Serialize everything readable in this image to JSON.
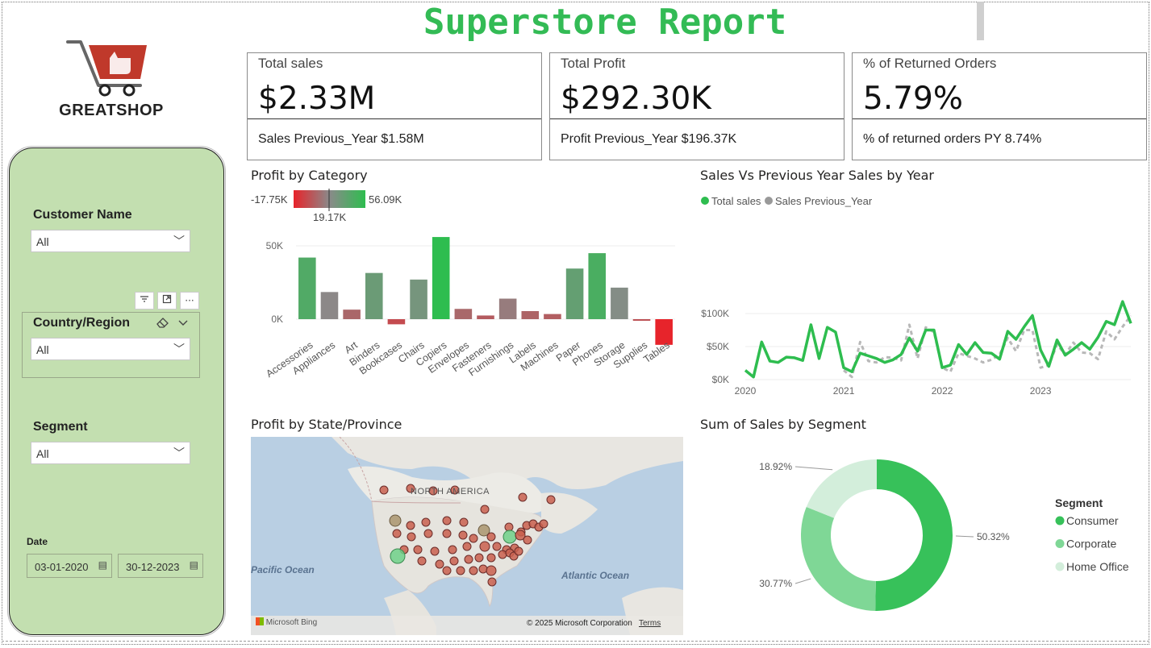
{
  "report": {
    "title": "Superstore Report",
    "logo_text": "GREATSHOP"
  },
  "colors": {
    "title": "#33bb55",
    "sidebar_bg": "#c3dfb0",
    "positive": "#2ebd4f",
    "negative": "#e8232a",
    "neutral": "#8a8a8a"
  },
  "filters": {
    "customer_name": {
      "label": "Customer Name",
      "value": "All"
    },
    "country_region": {
      "label": "Country/Region",
      "value": "All"
    },
    "segment": {
      "label": "Segment",
      "value": "All"
    },
    "date": {
      "label": "Date",
      "start": "03-01-2020",
      "end": "30-12-2023"
    },
    "toolbar_icons": [
      "filter-icon",
      "focus-mode-icon",
      "more-options-icon"
    ],
    "slicer_icons": [
      "eraser-icon",
      "chevron-up-icon"
    ]
  },
  "kpis": [
    {
      "label": "Total sales",
      "value": "$2.33M",
      "sub": "Sales Previous_Year $1.58M"
    },
    {
      "label": "Total Profit",
      "value": "$292.30K",
      "sub": "Profit Previous_Year $196.37K"
    },
    {
      "label": "% of Returned Orders",
      "value": "5.79%",
      "sub": "% of returned orders PY 8.74%"
    }
  ],
  "visuals": {
    "profit_by_category": "Profit by Category",
    "sales_vs_py": "Sales Vs Previous Year Sales by Year",
    "profit_by_state": "Profit by State/Province",
    "sales_by_segment": "Sum of Sales by Segment"
  },
  "map": {
    "labels": {
      "continent": "NORTH AMERICA",
      "pacific": "Pacific Ocean",
      "atlantic": "Atlantic Ocean"
    },
    "attribution": "© 2025 Microsoft Corporation",
    "terms": "Terms",
    "provider": "Microsoft Bing"
  },
  "chart_data": [
    {
      "type": "bar",
      "title": "Profit by Category",
      "color_scale": {
        "min_label": "-17.75K",
        "mid_label": "19.17K",
        "max_label": "56.09K",
        "min": -17.75,
        "mid": 19.17,
        "max": 56.09
      },
      "categories": [
        "Accessories",
        "Appliances",
        "Art",
        "Binders",
        "Bookcases",
        "Chairs",
        "Copiers",
        "Envelopes",
        "Fasteners",
        "Furnishings",
        "Labels",
        "Machines",
        "Paper",
        "Phones",
        "Storage",
        "Supplies",
        "Tables"
      ],
      "values": [
        42,
        18.5,
        6.5,
        31.5,
        -3.5,
        27,
        56,
        7,
        2.5,
        14,
        5.5,
        3.5,
        34.5,
        45,
        21.5,
        -1,
        -17.5
      ],
      "yticks": [
        "50K",
        "0K"
      ],
      "ytick_values": [
        50,
        0
      ],
      "ylim": [
        -20,
        60
      ]
    },
    {
      "type": "line",
      "title": "Sales Vs Previous Year Sales by Year",
      "series": [
        {
          "name": "Total sales",
          "values": [
            14,
            4,
            57,
            28,
            26,
            34,
            33,
            29,
            83,
            32,
            79,
            72,
            18,
            12,
            40,
            36,
            32,
            26,
            30,
            38,
            63,
            43,
            75,
            75,
            18,
            22,
            53,
            38,
            56,
            41,
            40,
            31,
            73,
            61,
            80,
            97,
            45,
            20,
            60,
            37,
            46,
            56,
            46,
            64,
            88,
            83,
            118,
            85
          ]
        },
        {
          "name": "Sales Previous_Year",
          "values": [
            null,
            null,
            null,
            null,
            null,
            null,
            null,
            null,
            null,
            null,
            null,
            null,
            14,
            4,
            57,
            28,
            26,
            34,
            33,
            29,
            83,
            32,
            79,
            72,
            18,
            12,
            40,
            36,
            32,
            26,
            30,
            38,
            63,
            43,
            75,
            75,
            18,
            22,
            53,
            38,
            56,
            41,
            40,
            31,
            73,
            61,
            80,
            97
          ]
        }
      ],
      "x_ticks": [
        "2020",
        "2021",
        "2022",
        "2023"
      ],
      "yticks": [
        "$100K",
        "$50K",
        "$0K"
      ],
      "ytick_values": [
        100,
        50,
        0
      ],
      "ylim": [
        0,
        120
      ],
      "legend": "top-left",
      "grid": true
    },
    {
      "type": "pie",
      "title": "Sum of Sales by Segment",
      "legend_title": "Segment",
      "categories": [
        "Consumer",
        "Corporate",
        "Home Office"
      ],
      "values": [
        50.32,
        30.77,
        18.92
      ],
      "labels": [
        "50.32%",
        "30.77%",
        "18.92%"
      ],
      "colors": [
        "#37c15a",
        "#7fd796",
        "#d3eedb"
      ],
      "donut": true
    }
  ]
}
